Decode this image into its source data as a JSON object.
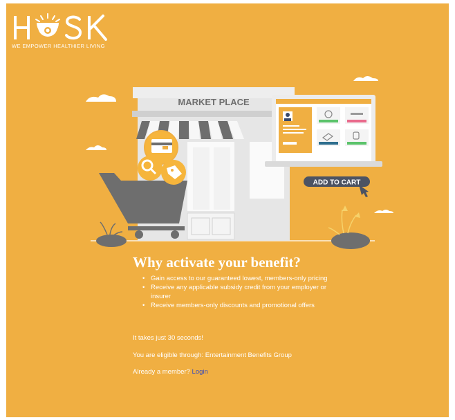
{
  "brand": {
    "logo_text": "HUSK",
    "tagline": "WE EMPOWER HEALTHIER LIVING"
  },
  "illustration": {
    "store_sign": "MARKET PLACE",
    "cart_label": "ADD TO CART"
  },
  "content": {
    "headline": "Why activate your benefit?",
    "benefits": [
      "Gain access to our guaranteed lowest, members-only pricing",
      "Receive any applicable subsidy credit from your employer or insurer",
      "Receive members-only discounts and promotional offers"
    ],
    "time_note": "It takes just 30 seconds!",
    "eligibility_prefix": "You are eligible through: Entertainment Benefits Group",
    "member_prompt": "Already a member?",
    "login_link": "Login"
  },
  "colors": {
    "background": "#F0AF42",
    "text": "#FFFFFF",
    "link": "#3B4CB8",
    "dark_gray": "#6E6E6E"
  }
}
